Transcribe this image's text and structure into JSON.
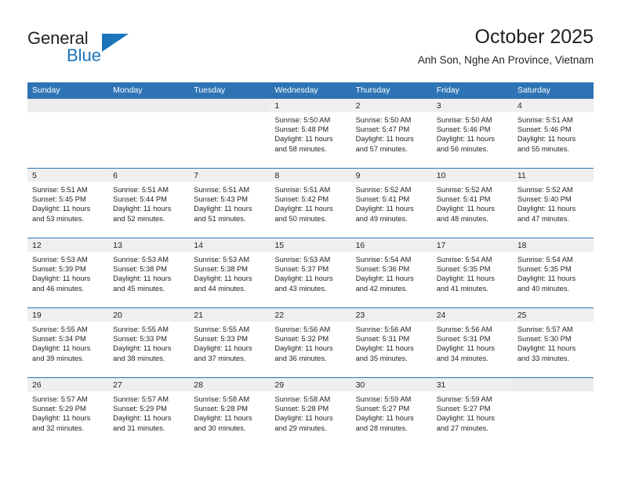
{
  "logo": {
    "word_one": "General",
    "word_two": "Blue",
    "triangle_icon": "triangle-icon",
    "accent_color": "#1b75bb"
  },
  "header": {
    "title": "October 2025",
    "subtitle": "Anh Son, Nghe An Province, Vietnam"
  },
  "theme": {
    "header_blue": "#2e74b5",
    "daynum_band": "#efefef",
    "text": "#231f20"
  },
  "calendar": {
    "weekday_headers": [
      "Sunday",
      "Monday",
      "Tuesday",
      "Wednesday",
      "Thursday",
      "Friday",
      "Saturday"
    ],
    "labels": {
      "sunrise": "Sunrise:",
      "sunset": "Sunset:",
      "daylight": "Daylight:"
    },
    "weeks": [
      [
        {
          "day": "",
          "sunrise": "",
          "sunset": "",
          "daylight_l1": "",
          "daylight_l2": ""
        },
        {
          "day": "",
          "sunrise": "",
          "sunset": "",
          "daylight_l1": "",
          "daylight_l2": ""
        },
        {
          "day": "",
          "sunrise": "",
          "sunset": "",
          "daylight_l1": "",
          "daylight_l2": ""
        },
        {
          "day": "1",
          "sunrise": "Sunrise: 5:50 AM",
          "sunset": "Sunset: 5:48 PM",
          "daylight_l1": "Daylight: 11 hours",
          "daylight_l2": "and 58 minutes."
        },
        {
          "day": "2",
          "sunrise": "Sunrise: 5:50 AM",
          "sunset": "Sunset: 5:47 PM",
          "daylight_l1": "Daylight: 11 hours",
          "daylight_l2": "and 57 minutes."
        },
        {
          "day": "3",
          "sunrise": "Sunrise: 5:50 AM",
          "sunset": "Sunset: 5:46 PM",
          "daylight_l1": "Daylight: 11 hours",
          "daylight_l2": "and 56 minutes."
        },
        {
          "day": "4",
          "sunrise": "Sunrise: 5:51 AM",
          "sunset": "Sunset: 5:46 PM",
          "daylight_l1": "Daylight: 11 hours",
          "daylight_l2": "and 55 minutes."
        }
      ],
      [
        {
          "day": "5",
          "sunrise": "Sunrise: 5:51 AM",
          "sunset": "Sunset: 5:45 PM",
          "daylight_l1": "Daylight: 11 hours",
          "daylight_l2": "and 53 minutes."
        },
        {
          "day": "6",
          "sunrise": "Sunrise: 5:51 AM",
          "sunset": "Sunset: 5:44 PM",
          "daylight_l1": "Daylight: 11 hours",
          "daylight_l2": "and 52 minutes."
        },
        {
          "day": "7",
          "sunrise": "Sunrise: 5:51 AM",
          "sunset": "Sunset: 5:43 PM",
          "daylight_l1": "Daylight: 11 hours",
          "daylight_l2": "and 51 minutes."
        },
        {
          "day": "8",
          "sunrise": "Sunrise: 5:51 AM",
          "sunset": "Sunset: 5:42 PM",
          "daylight_l1": "Daylight: 11 hours",
          "daylight_l2": "and 50 minutes."
        },
        {
          "day": "9",
          "sunrise": "Sunrise: 5:52 AM",
          "sunset": "Sunset: 5:41 PM",
          "daylight_l1": "Daylight: 11 hours",
          "daylight_l2": "and 49 minutes."
        },
        {
          "day": "10",
          "sunrise": "Sunrise: 5:52 AM",
          "sunset": "Sunset: 5:41 PM",
          "daylight_l1": "Daylight: 11 hours",
          "daylight_l2": "and 48 minutes."
        },
        {
          "day": "11",
          "sunrise": "Sunrise: 5:52 AM",
          "sunset": "Sunset: 5:40 PM",
          "daylight_l1": "Daylight: 11 hours",
          "daylight_l2": "and 47 minutes."
        }
      ],
      [
        {
          "day": "12",
          "sunrise": "Sunrise: 5:53 AM",
          "sunset": "Sunset: 5:39 PM",
          "daylight_l1": "Daylight: 11 hours",
          "daylight_l2": "and 46 minutes."
        },
        {
          "day": "13",
          "sunrise": "Sunrise: 5:53 AM",
          "sunset": "Sunset: 5:38 PM",
          "daylight_l1": "Daylight: 11 hours",
          "daylight_l2": "and 45 minutes."
        },
        {
          "day": "14",
          "sunrise": "Sunrise: 5:53 AM",
          "sunset": "Sunset: 5:38 PM",
          "daylight_l1": "Daylight: 11 hours",
          "daylight_l2": "and 44 minutes."
        },
        {
          "day": "15",
          "sunrise": "Sunrise: 5:53 AM",
          "sunset": "Sunset: 5:37 PM",
          "daylight_l1": "Daylight: 11 hours",
          "daylight_l2": "and 43 minutes."
        },
        {
          "day": "16",
          "sunrise": "Sunrise: 5:54 AM",
          "sunset": "Sunset: 5:36 PM",
          "daylight_l1": "Daylight: 11 hours",
          "daylight_l2": "and 42 minutes."
        },
        {
          "day": "17",
          "sunrise": "Sunrise: 5:54 AM",
          "sunset": "Sunset: 5:35 PM",
          "daylight_l1": "Daylight: 11 hours",
          "daylight_l2": "and 41 minutes."
        },
        {
          "day": "18",
          "sunrise": "Sunrise: 5:54 AM",
          "sunset": "Sunset: 5:35 PM",
          "daylight_l1": "Daylight: 11 hours",
          "daylight_l2": "and 40 minutes."
        }
      ],
      [
        {
          "day": "19",
          "sunrise": "Sunrise: 5:55 AM",
          "sunset": "Sunset: 5:34 PM",
          "daylight_l1": "Daylight: 11 hours",
          "daylight_l2": "and 39 minutes."
        },
        {
          "day": "20",
          "sunrise": "Sunrise: 5:55 AM",
          "sunset": "Sunset: 5:33 PM",
          "daylight_l1": "Daylight: 11 hours",
          "daylight_l2": "and 38 minutes."
        },
        {
          "day": "21",
          "sunrise": "Sunrise: 5:55 AM",
          "sunset": "Sunset: 5:33 PM",
          "daylight_l1": "Daylight: 11 hours",
          "daylight_l2": "and 37 minutes."
        },
        {
          "day": "22",
          "sunrise": "Sunrise: 5:56 AM",
          "sunset": "Sunset: 5:32 PM",
          "daylight_l1": "Daylight: 11 hours",
          "daylight_l2": "and 36 minutes."
        },
        {
          "day": "23",
          "sunrise": "Sunrise: 5:56 AM",
          "sunset": "Sunset: 5:31 PM",
          "daylight_l1": "Daylight: 11 hours",
          "daylight_l2": "and 35 minutes."
        },
        {
          "day": "24",
          "sunrise": "Sunrise: 5:56 AM",
          "sunset": "Sunset: 5:31 PM",
          "daylight_l1": "Daylight: 11 hours",
          "daylight_l2": "and 34 minutes."
        },
        {
          "day": "25",
          "sunrise": "Sunrise: 5:57 AM",
          "sunset": "Sunset: 5:30 PM",
          "daylight_l1": "Daylight: 11 hours",
          "daylight_l2": "and 33 minutes."
        }
      ],
      [
        {
          "day": "26",
          "sunrise": "Sunrise: 5:57 AM",
          "sunset": "Sunset: 5:29 PM",
          "daylight_l1": "Daylight: 11 hours",
          "daylight_l2": "and 32 minutes."
        },
        {
          "day": "27",
          "sunrise": "Sunrise: 5:57 AM",
          "sunset": "Sunset: 5:29 PM",
          "daylight_l1": "Daylight: 11 hours",
          "daylight_l2": "and 31 minutes."
        },
        {
          "day": "28",
          "sunrise": "Sunrise: 5:58 AM",
          "sunset": "Sunset: 5:28 PM",
          "daylight_l1": "Daylight: 11 hours",
          "daylight_l2": "and 30 minutes."
        },
        {
          "day": "29",
          "sunrise": "Sunrise: 5:58 AM",
          "sunset": "Sunset: 5:28 PM",
          "daylight_l1": "Daylight: 11 hours",
          "daylight_l2": "and 29 minutes."
        },
        {
          "day": "30",
          "sunrise": "Sunrise: 5:59 AM",
          "sunset": "Sunset: 5:27 PM",
          "daylight_l1": "Daylight: 11 hours",
          "daylight_l2": "and 28 minutes."
        },
        {
          "day": "31",
          "sunrise": "Sunrise: 5:59 AM",
          "sunset": "Sunset: 5:27 PM",
          "daylight_l1": "Daylight: 11 hours",
          "daylight_l2": "and 27 minutes."
        },
        {
          "day": "",
          "sunrise": "",
          "sunset": "",
          "daylight_l1": "",
          "daylight_l2": ""
        }
      ]
    ]
  }
}
